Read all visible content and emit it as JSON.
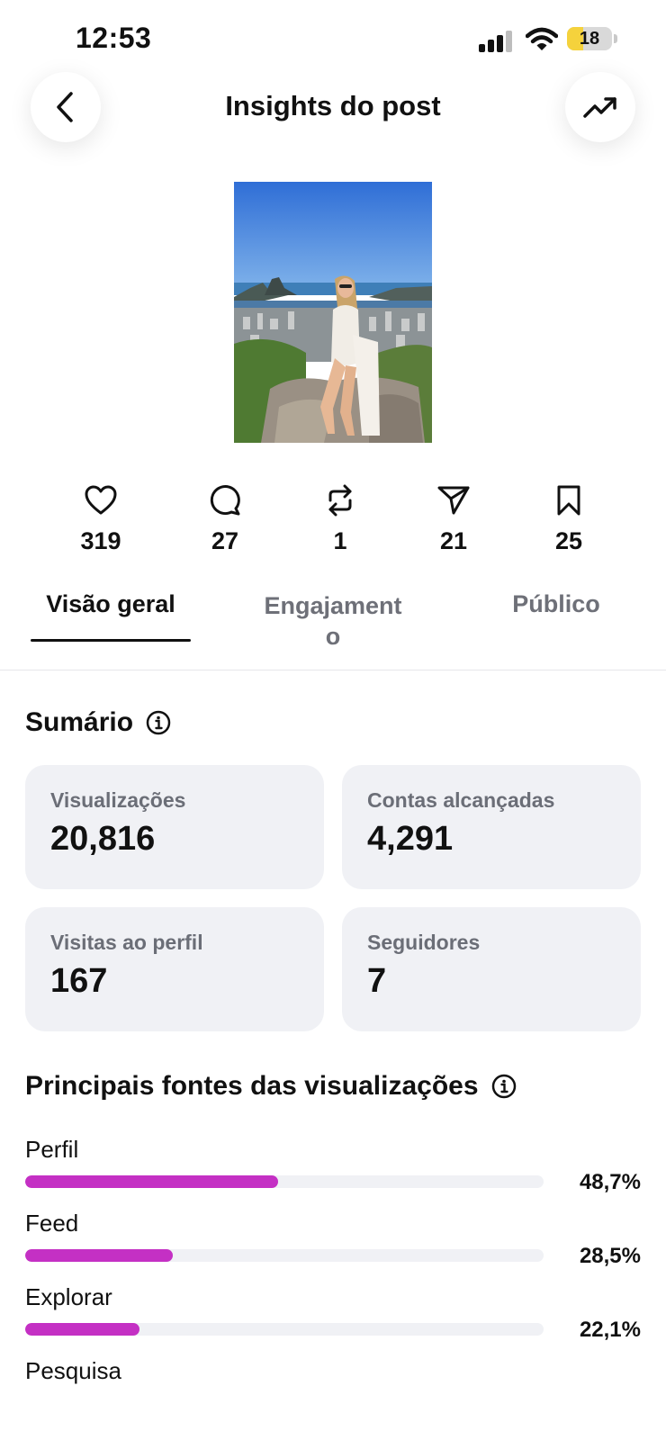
{
  "status_bar": {
    "time": "12:53",
    "battery": "18"
  },
  "header": {
    "title": "Insights do post",
    "back_icon": "chevron-left-icon",
    "trend_icon": "trending-up-icon"
  },
  "stats": [
    {
      "icon": "heart-icon",
      "value": "319"
    },
    {
      "icon": "comment-icon",
      "value": "27"
    },
    {
      "icon": "repost-icon",
      "value": "1"
    },
    {
      "icon": "share-icon",
      "value": "21"
    },
    {
      "icon": "bookmark-icon",
      "value": "25"
    }
  ],
  "tabs": {
    "overview": "Visão geral",
    "engagement_line1": "Engajament",
    "engagement_line2": "o",
    "audience": "Público"
  },
  "summary": {
    "title": "Sumário",
    "cards": [
      {
        "label": "Visualizações",
        "value": "20,816"
      },
      {
        "label": "Contas alcançadas",
        "value": "4,291"
      },
      {
        "label": "Visitas ao perfil",
        "value": "167"
      },
      {
        "label": "Seguidores",
        "value": "7"
      }
    ]
  },
  "sources": {
    "title": "Principais fontes das visualizações",
    "items": [
      {
        "label": "Perfil",
        "percent_text": "48,7%",
        "fraction": 0.487
      },
      {
        "label": "Feed",
        "percent_text": "28,5%",
        "fraction": 0.285
      },
      {
        "label": "Explorar",
        "percent_text": "22,1%",
        "fraction": 0.221
      },
      {
        "label": "Pesquisa"
      }
    ]
  },
  "colors": {
    "accent_bar": "#c430c4",
    "card_bg": "#f0f1f5",
    "muted_text": "#6e7078"
  }
}
